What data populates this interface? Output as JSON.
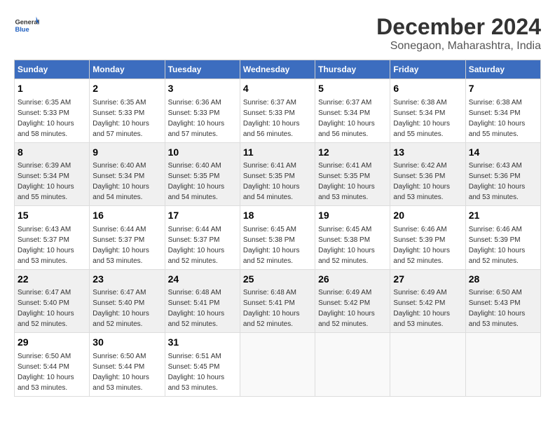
{
  "header": {
    "logo_line1": "General",
    "logo_line2": "Blue",
    "title": "December 2024",
    "subtitle": "Sonegaon, Maharashtra, India"
  },
  "calendar": {
    "days_of_week": [
      "Sunday",
      "Monday",
      "Tuesday",
      "Wednesday",
      "Thursday",
      "Friday",
      "Saturday"
    ],
    "weeks": [
      [
        {
          "day": "",
          "empty": true
        },
        {
          "day": "",
          "empty": true
        },
        {
          "day": "",
          "empty": true
        },
        {
          "day": "",
          "empty": true
        },
        {
          "day": "",
          "empty": true
        },
        {
          "day": "",
          "empty": true
        },
        {
          "day": "",
          "empty": true
        }
      ],
      [
        {
          "day": "1",
          "sunrise": "6:35 AM",
          "sunset": "5:33 PM",
          "daylight": "10 hours and 58 minutes."
        },
        {
          "day": "2",
          "sunrise": "6:35 AM",
          "sunset": "5:33 PM",
          "daylight": "10 hours and 57 minutes."
        },
        {
          "day": "3",
          "sunrise": "6:36 AM",
          "sunset": "5:33 PM",
          "daylight": "10 hours and 57 minutes."
        },
        {
          "day": "4",
          "sunrise": "6:37 AM",
          "sunset": "5:33 PM",
          "daylight": "10 hours and 56 minutes."
        },
        {
          "day": "5",
          "sunrise": "6:37 AM",
          "sunset": "5:34 PM",
          "daylight": "10 hours and 56 minutes."
        },
        {
          "day": "6",
          "sunrise": "6:38 AM",
          "sunset": "5:34 PM",
          "daylight": "10 hours and 55 minutes."
        },
        {
          "day": "7",
          "sunrise": "6:38 AM",
          "sunset": "5:34 PM",
          "daylight": "10 hours and 55 minutes."
        }
      ],
      [
        {
          "day": "8",
          "sunrise": "6:39 AM",
          "sunset": "5:34 PM",
          "daylight": "10 hours and 55 minutes."
        },
        {
          "day": "9",
          "sunrise": "6:40 AM",
          "sunset": "5:34 PM",
          "daylight": "10 hours and 54 minutes."
        },
        {
          "day": "10",
          "sunrise": "6:40 AM",
          "sunset": "5:35 PM",
          "daylight": "10 hours and 54 minutes."
        },
        {
          "day": "11",
          "sunrise": "6:41 AM",
          "sunset": "5:35 PM",
          "daylight": "10 hours and 54 minutes."
        },
        {
          "day": "12",
          "sunrise": "6:41 AM",
          "sunset": "5:35 PM",
          "daylight": "10 hours and 53 minutes."
        },
        {
          "day": "13",
          "sunrise": "6:42 AM",
          "sunset": "5:36 PM",
          "daylight": "10 hours and 53 minutes."
        },
        {
          "day": "14",
          "sunrise": "6:43 AM",
          "sunset": "5:36 PM",
          "daylight": "10 hours and 53 minutes."
        }
      ],
      [
        {
          "day": "15",
          "sunrise": "6:43 AM",
          "sunset": "5:37 PM",
          "daylight": "10 hours and 53 minutes."
        },
        {
          "day": "16",
          "sunrise": "6:44 AM",
          "sunset": "5:37 PM",
          "daylight": "10 hours and 53 minutes."
        },
        {
          "day": "17",
          "sunrise": "6:44 AM",
          "sunset": "5:37 PM",
          "daylight": "10 hours and 52 minutes."
        },
        {
          "day": "18",
          "sunrise": "6:45 AM",
          "sunset": "5:38 PM",
          "daylight": "10 hours and 52 minutes."
        },
        {
          "day": "19",
          "sunrise": "6:45 AM",
          "sunset": "5:38 PM",
          "daylight": "10 hours and 52 minutes."
        },
        {
          "day": "20",
          "sunrise": "6:46 AM",
          "sunset": "5:39 PM",
          "daylight": "10 hours and 52 minutes."
        },
        {
          "day": "21",
          "sunrise": "6:46 AM",
          "sunset": "5:39 PM",
          "daylight": "10 hours and 52 minutes."
        }
      ],
      [
        {
          "day": "22",
          "sunrise": "6:47 AM",
          "sunset": "5:40 PM",
          "daylight": "10 hours and 52 minutes."
        },
        {
          "day": "23",
          "sunrise": "6:47 AM",
          "sunset": "5:40 PM",
          "daylight": "10 hours and 52 minutes."
        },
        {
          "day": "24",
          "sunrise": "6:48 AM",
          "sunset": "5:41 PM",
          "daylight": "10 hours and 52 minutes."
        },
        {
          "day": "25",
          "sunrise": "6:48 AM",
          "sunset": "5:41 PM",
          "daylight": "10 hours and 52 minutes."
        },
        {
          "day": "26",
          "sunrise": "6:49 AM",
          "sunset": "5:42 PM",
          "daylight": "10 hours and 52 minutes."
        },
        {
          "day": "27",
          "sunrise": "6:49 AM",
          "sunset": "5:42 PM",
          "daylight": "10 hours and 53 minutes."
        },
        {
          "day": "28",
          "sunrise": "6:50 AM",
          "sunset": "5:43 PM",
          "daylight": "10 hours and 53 minutes."
        }
      ],
      [
        {
          "day": "29",
          "sunrise": "6:50 AM",
          "sunset": "5:44 PM",
          "daylight": "10 hours and 53 minutes."
        },
        {
          "day": "30",
          "sunrise": "6:50 AM",
          "sunset": "5:44 PM",
          "daylight": "10 hours and 53 minutes."
        },
        {
          "day": "31",
          "sunrise": "6:51 AM",
          "sunset": "5:45 PM",
          "daylight": "10 hours and 53 minutes."
        },
        {
          "day": "",
          "empty": true
        },
        {
          "day": "",
          "empty": true
        },
        {
          "day": "",
          "empty": true
        },
        {
          "day": "",
          "empty": true
        }
      ]
    ]
  }
}
